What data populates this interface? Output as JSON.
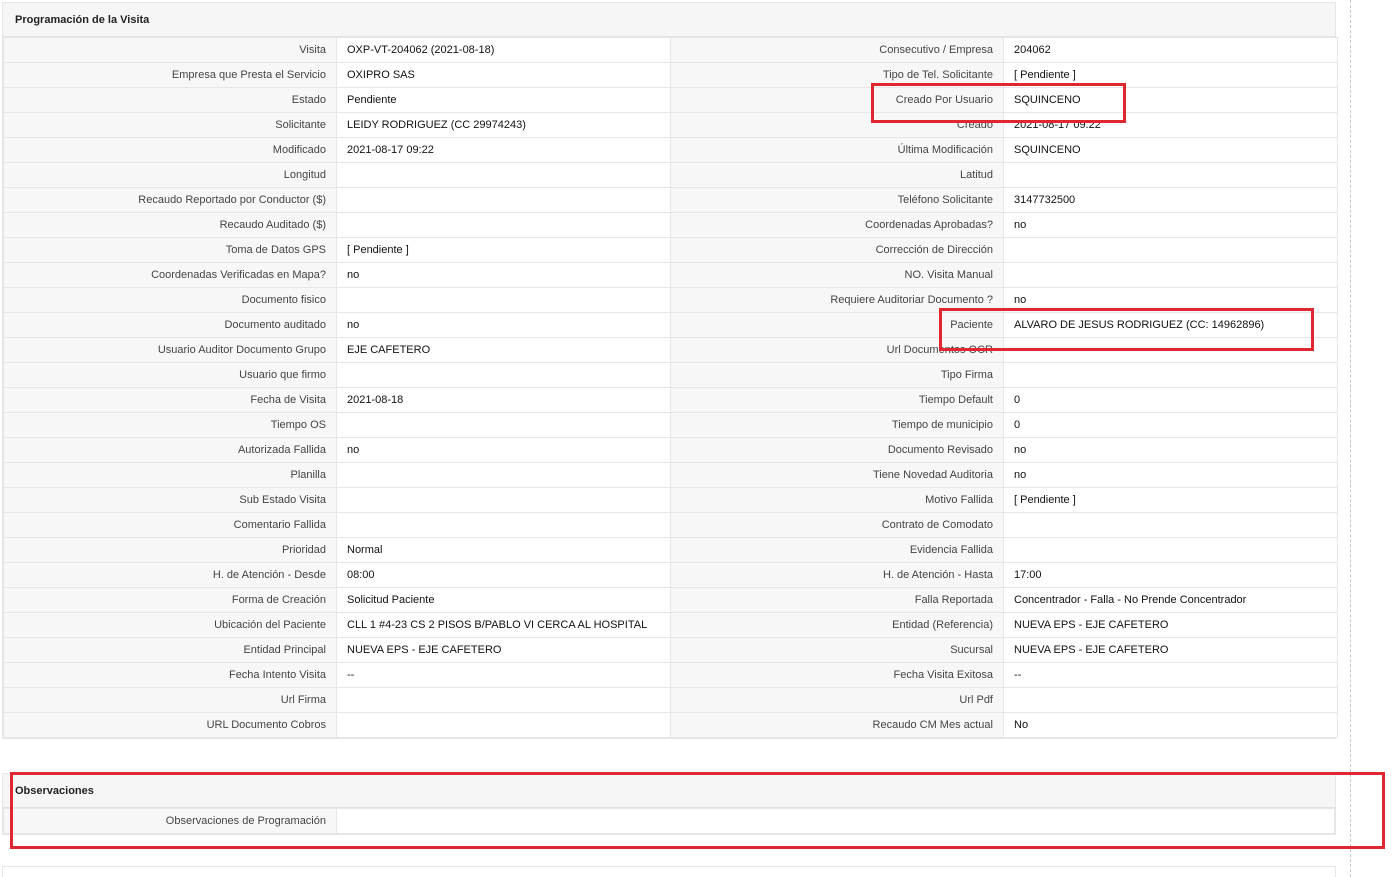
{
  "section_main": {
    "title": "Programación de la Visita",
    "rows": [
      {
        "l1": "Visita",
        "v1": "OXP-VT-204062 (2021-08-18)",
        "l2": "Consecutivo / Empresa",
        "v2": "204062"
      },
      {
        "l1": "Empresa que Presta el Servicio",
        "v1": "OXIPRO SAS",
        "l2": "Tipo de Tel. Solicitante",
        "v2": "[ Pendiente ]"
      },
      {
        "l1": "Estado",
        "v1": "Pendiente",
        "l2": "Creado Por Usuario",
        "v2": "SQUINCENO"
      },
      {
        "l1": "Solicitante",
        "v1": "LEIDY RODRIGUEZ (CC 29974243)",
        "l2": "Creado",
        "v2": "2021-08-17 09:22"
      },
      {
        "l1": "Modificado",
        "v1": "2021-08-17 09:22",
        "l2": "Última Modificación",
        "v2": " SQUINCENO"
      },
      {
        "l1": "Longitud",
        "v1": "",
        "l2": "Latitud",
        "v2": ""
      },
      {
        "l1": "Recaudo Reportado por Conductor ($)",
        "v1": "",
        "l2": "Teléfono Solicitante",
        "v2": "3147732500"
      },
      {
        "l1": "Recaudo Auditado ($)",
        "v1": "",
        "l2": "Coordenadas Aprobadas?",
        "v2": " no"
      },
      {
        "l1": "Toma de Datos GPS",
        "v1": "[ Pendiente ]",
        "l2": "Corrección de Dirección",
        "v2": ""
      },
      {
        "l1": "Coordenadas Verificadas en Mapa?",
        "v1": " no",
        "l2": "NO. Visita Manual",
        "v2": ""
      },
      {
        "l1": "Documento fisico",
        "v1": "",
        "l2": "Requiere Auditoriar Documento ?",
        "v2": " no"
      },
      {
        "l1": "Documento auditado",
        "v1": " no",
        "l2": "Paciente",
        "v2": "ALVARO DE JESUS RODRIGUEZ (CC: 14962896)"
      },
      {
        "l1": "Usuario Auditor Documento Grupo",
        "v1": "EJE CAFETERO",
        "l2": "Url Documentos OCR",
        "v2": ""
      },
      {
        "l1": "Usuario que firmo",
        "v1": "",
        "l2": "Tipo Firma",
        "v2": ""
      },
      {
        "l1": "Fecha de Visita",
        "v1": " 2021-08-18",
        "l2": "Tiempo Default",
        "v2": "0"
      },
      {
        "l1": "Tiempo OS",
        "v1": "",
        "l2": "Tiempo de municipio",
        "v2": "0"
      },
      {
        "l1": "Autorizada Fallida",
        "v1": " no",
        "l2": "Documento Revisado",
        "v2": " no"
      },
      {
        "l1": "Planilla",
        "v1": "",
        "l2": "Tiene Novedad Auditoria",
        "v2": " no"
      },
      {
        "l1": "Sub Estado Visita",
        "v1": "",
        "l2": "Motivo Fallida",
        "v2": "[ Pendiente ]"
      },
      {
        "l1": "Comentario Fallida",
        "v1": "",
        "l2": "Contrato de Comodato",
        "v2": ""
      },
      {
        "l1": "Prioridad",
        "v1": "Normal",
        "l2": "Evidencia Fallida",
        "v2": ""
      },
      {
        "l1": "H. de Atención - Desde",
        "v1": "08:00",
        "l2": "H. de Atención - Hasta",
        "v2": "17:00"
      },
      {
        "l1": "Forma de Creación",
        "v1": "Solicitud Paciente",
        "l2": "Falla Reportada",
        "v2": "Concentrador - Falla - No Prende Concentrador"
      },
      {
        "l1": "Ubicación del Paciente",
        "v1": "CLL 1 #4-23 CS 2 PISOS B/PABLO VI CERCA AL HOSPITAL",
        "l2": "Entidad (Referencia)",
        "v2": "NUEVA EPS - EJE CAFETERO"
      },
      {
        "l1": "Entidad Principal",
        "v1": "NUEVA EPS - EJE CAFETERO",
        "l2": "Sucursal",
        "v2": "NUEVA EPS - EJE CAFETERO"
      },
      {
        "l1": "Fecha Intento Visita",
        "v1": " --",
        "l2": "Fecha Visita Exitosa",
        "v2": " --"
      },
      {
        "l1": "Url Firma",
        "v1": "",
        "l2": "Url Pdf",
        "v2": ""
      },
      {
        "l1": "URL Documento Cobros",
        "v1": "",
        "l2": "Recaudo CM Mes actual",
        "v2": "No"
      }
    ]
  },
  "section_obs": {
    "title": "Observaciones",
    "rows": [
      {
        "label": "Observaciones de Programación",
        "value": ""
      }
    ]
  },
  "colors": {
    "highlight": "#e0262f",
    "header_bg": "#f6f6f6",
    "label_bg": "#f7f7f7",
    "border": "#e6e6e6"
  }
}
